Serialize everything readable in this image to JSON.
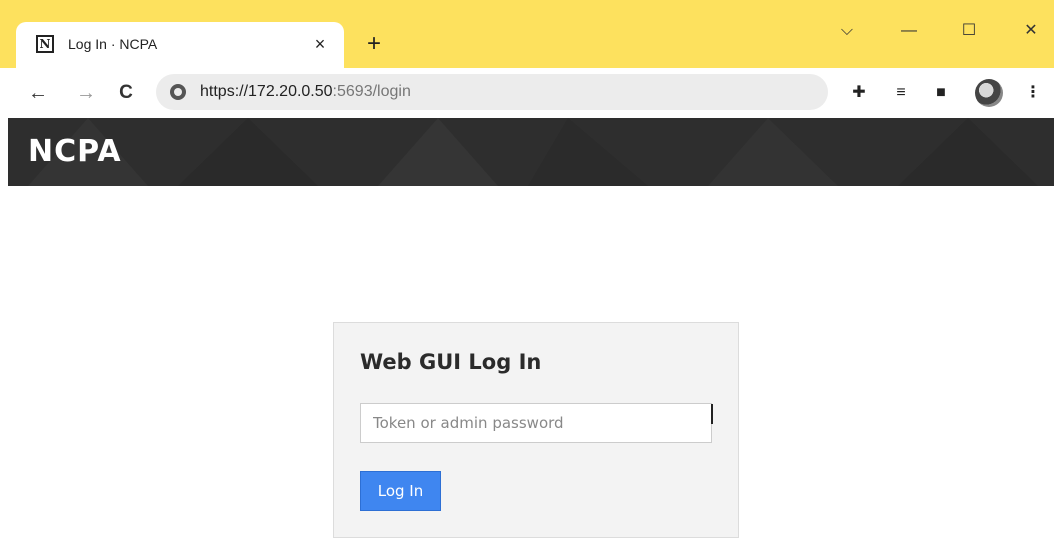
{
  "browser": {
    "tab": {
      "title": "Log In · NCPA",
      "favicon_letter": "N",
      "close_glyph": "×"
    },
    "new_tab_glyph": "+",
    "window_controls": {
      "tab_search_glyph": "⌵",
      "minimize_glyph": "—",
      "maximize_glyph": "☐",
      "close_glyph": "✕"
    },
    "toolbar": {
      "back_glyph": "←",
      "forward_glyph": "→",
      "reload_glyph": "C",
      "url_host": "https://172.20.0.50",
      "url_rest": ":5693/login",
      "extensions_glyph": "✚",
      "reading_list_glyph": "≡",
      "side_panel_glyph": "■",
      "menu_glyph": "⋮"
    }
  },
  "header": {
    "brand": "NCPA"
  },
  "login": {
    "title": "Web GUI Log In",
    "token_placeholder": "Token or admin password",
    "token_value": "",
    "submit_label": "Log In"
  },
  "colors": {
    "tabstrip": "#fde15e",
    "banner": "#2e2e2e",
    "button": "#3f86f0",
    "panel": "#f3f3f3"
  }
}
